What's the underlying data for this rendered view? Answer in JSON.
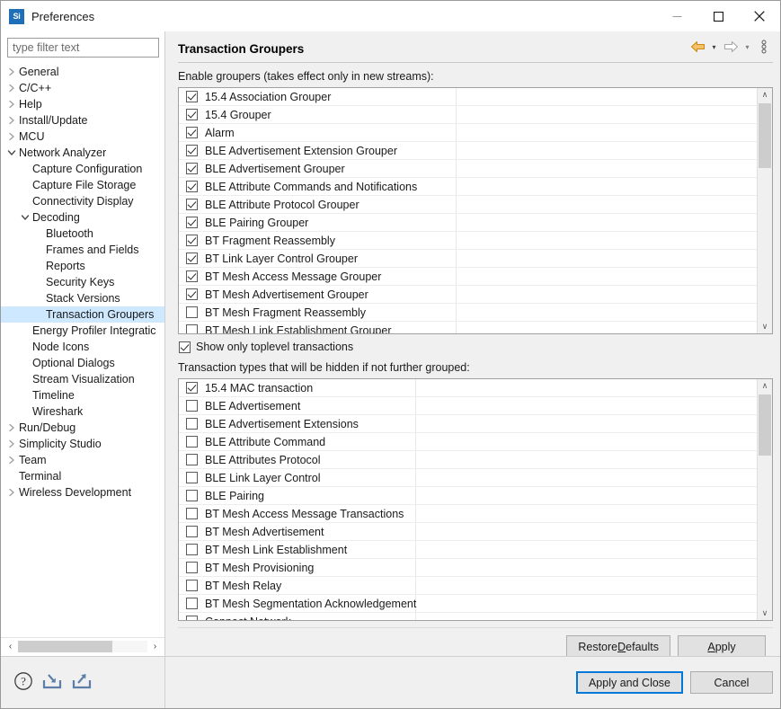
{
  "window": {
    "title": "Preferences",
    "app_icon": "Si",
    "minimize_label": "Minimize",
    "maximize_label": "Maximize",
    "close_label": "Close"
  },
  "sidebar": {
    "filter_placeholder": "type filter text",
    "filter_value": "",
    "items": [
      {
        "label": "General",
        "indent": 0,
        "arrow": "collapsed",
        "selected": false
      },
      {
        "label": "C/C++",
        "indent": 0,
        "arrow": "collapsed",
        "selected": false
      },
      {
        "label": "Help",
        "indent": 0,
        "arrow": "collapsed",
        "selected": false
      },
      {
        "label": "Install/Update",
        "indent": 0,
        "arrow": "collapsed",
        "selected": false
      },
      {
        "label": "MCU",
        "indent": 0,
        "arrow": "collapsed",
        "selected": false
      },
      {
        "label": "Network Analyzer",
        "indent": 0,
        "arrow": "expanded",
        "selected": false
      },
      {
        "label": "Capture Configuration",
        "indent": 1,
        "arrow": "none",
        "selected": false
      },
      {
        "label": "Capture File Storage",
        "indent": 1,
        "arrow": "none",
        "selected": false
      },
      {
        "label": "Connectivity Display",
        "indent": 1,
        "arrow": "none",
        "selected": false
      },
      {
        "label": "Decoding",
        "indent": 1,
        "arrow": "expanded",
        "selected": false
      },
      {
        "label": "Bluetooth",
        "indent": 2,
        "arrow": "none",
        "selected": false
      },
      {
        "label": "Frames and Fields",
        "indent": 2,
        "arrow": "none",
        "selected": false
      },
      {
        "label": "Reports",
        "indent": 2,
        "arrow": "none",
        "selected": false
      },
      {
        "label": "Security Keys",
        "indent": 2,
        "arrow": "none",
        "selected": false
      },
      {
        "label": "Stack Versions",
        "indent": 2,
        "arrow": "none",
        "selected": false
      },
      {
        "label": "Transaction Groupers",
        "indent": 2,
        "arrow": "none",
        "selected": true
      },
      {
        "label": "Energy Profiler Integratic",
        "indent": 1,
        "arrow": "none",
        "selected": false
      },
      {
        "label": "Node Icons",
        "indent": 1,
        "arrow": "none",
        "selected": false
      },
      {
        "label": "Optional Dialogs",
        "indent": 1,
        "arrow": "none",
        "selected": false
      },
      {
        "label": "Stream Visualization",
        "indent": 1,
        "arrow": "none",
        "selected": false
      },
      {
        "label": "Timeline",
        "indent": 1,
        "arrow": "none",
        "selected": false
      },
      {
        "label": "Wireshark",
        "indent": 1,
        "arrow": "none",
        "selected": false
      },
      {
        "label": "Run/Debug",
        "indent": 0,
        "arrow": "collapsed",
        "selected": false
      },
      {
        "label": "Simplicity Studio",
        "indent": 0,
        "arrow": "collapsed",
        "selected": false
      },
      {
        "label": "Team",
        "indent": 0,
        "arrow": "collapsed",
        "selected": false
      },
      {
        "label": "Terminal",
        "indent": 0,
        "arrow": "none",
        "selected": false
      },
      {
        "label": "Wireless Development",
        "indent": 0,
        "arrow": "collapsed",
        "selected": false
      }
    ],
    "hscroll": {
      "left_arrow": "‹",
      "right_arrow": "›",
      "thumb_pct": 73
    }
  },
  "page": {
    "title": "Transaction Groupers",
    "toolbar": {
      "back_icon": "back-arrow-icon",
      "back_caret": "▾",
      "forward_icon": "forward-arrow-icon",
      "forward_caret": "▾",
      "menu_icon": "vertical-dots-icon"
    },
    "groupers_label": "Enable groupers (takes effect only in new streams):",
    "groupers": [
      {
        "label": "15.4 Association Grouper",
        "checked": true
      },
      {
        "label": "15.4 Grouper",
        "checked": true
      },
      {
        "label": "Alarm",
        "checked": true
      },
      {
        "label": "BLE Advertisement Extension Grouper",
        "checked": true
      },
      {
        "label": "BLE Advertisement Grouper",
        "checked": true
      },
      {
        "label": "BLE Attribute Commands and Notifications",
        "checked": true
      },
      {
        "label": "BLE Attribute Protocol Grouper",
        "checked": true
      },
      {
        "label": "BLE Pairing Grouper",
        "checked": true
      },
      {
        "label": "BT Fragment Reassembly",
        "checked": true
      },
      {
        "label": "BT Link Layer Control Grouper",
        "checked": true
      },
      {
        "label": "BT Mesh Access Message Grouper",
        "checked": true
      },
      {
        "label": "BT Mesh Advertisement Grouper",
        "checked": true
      },
      {
        "label": "BT Mesh Fragment Reassembly",
        "checked": false
      },
      {
        "label": "BT Mesh Link Establishment Grouper",
        "checked": false
      }
    ],
    "toplevel_checkbox": {
      "label": "Show only toplevel transactions",
      "checked": true
    },
    "hidden_types_label": "Transaction types that will be hidden if not further grouped:",
    "hidden_types": [
      {
        "label": "15.4 MAC transaction",
        "checked": true
      },
      {
        "label": "BLE Advertisement",
        "checked": false
      },
      {
        "label": "BLE Advertisement Extensions",
        "checked": false
      },
      {
        "label": "BLE Attribute Command",
        "checked": false
      },
      {
        "label": "BLE Attributes Protocol",
        "checked": false
      },
      {
        "label": "BLE Link Layer Control",
        "checked": false
      },
      {
        "label": "BLE Pairing",
        "checked": false
      },
      {
        "label": "BT Mesh Access Message Transactions",
        "checked": false
      },
      {
        "label": "BT Mesh Advertisement",
        "checked": false
      },
      {
        "label": "BT Mesh Link Establishment",
        "checked": false
      },
      {
        "label": "BT Mesh Provisioning",
        "checked": false
      },
      {
        "label": "BT Mesh Relay",
        "checked": false
      },
      {
        "label": "BT Mesh Segmentation Acknowledgement",
        "checked": false
      },
      {
        "label": "Connect Network",
        "checked": false
      }
    ],
    "scrollbar": {
      "up_arrow": "∧",
      "down_arrow": "∨"
    }
  },
  "buttons": {
    "restore_defaults_pre": "Restore ",
    "restore_defaults_key": "D",
    "restore_defaults_post": "efaults",
    "apply_key": "A",
    "apply_post": "pply",
    "apply_and_close": "Apply and Close",
    "cancel": "Cancel"
  },
  "bottom_icons": {
    "help": "help-icon",
    "import": "import-icon",
    "export": "export-icon"
  },
  "colors": {
    "selection": "#cde8ff",
    "default_button_border": "#0078d7",
    "back_arrow": "#e8a33d",
    "window_bg": "#f0f0f0",
    "icon_blue": "#5b7fa8"
  }
}
